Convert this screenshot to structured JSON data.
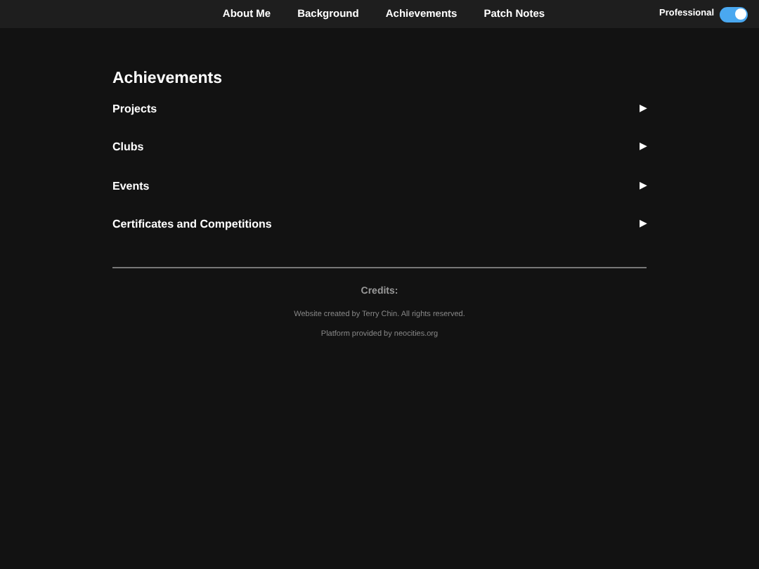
{
  "nav": {
    "links": [
      {
        "label": "About Me"
      },
      {
        "label": "Background"
      },
      {
        "label": "Achievements"
      },
      {
        "label": "Patch Notes"
      }
    ],
    "toggle": {
      "label": "Professional",
      "on": true
    }
  },
  "section": {
    "title": "Achievements",
    "items": [
      {
        "label": "Projects",
        "arrow": "▶"
      },
      {
        "label": "Clubs",
        "arrow": "▶"
      },
      {
        "label": "Events",
        "arrow": "▶"
      },
      {
        "label": "Certificates and Competitions",
        "arrow": "▶"
      }
    ]
  },
  "footer": {
    "title": "Credits:",
    "lines": [
      "Website created by Terry Chin. All rights reserved.",
      "Platform provided by neocities.org"
    ]
  }
}
